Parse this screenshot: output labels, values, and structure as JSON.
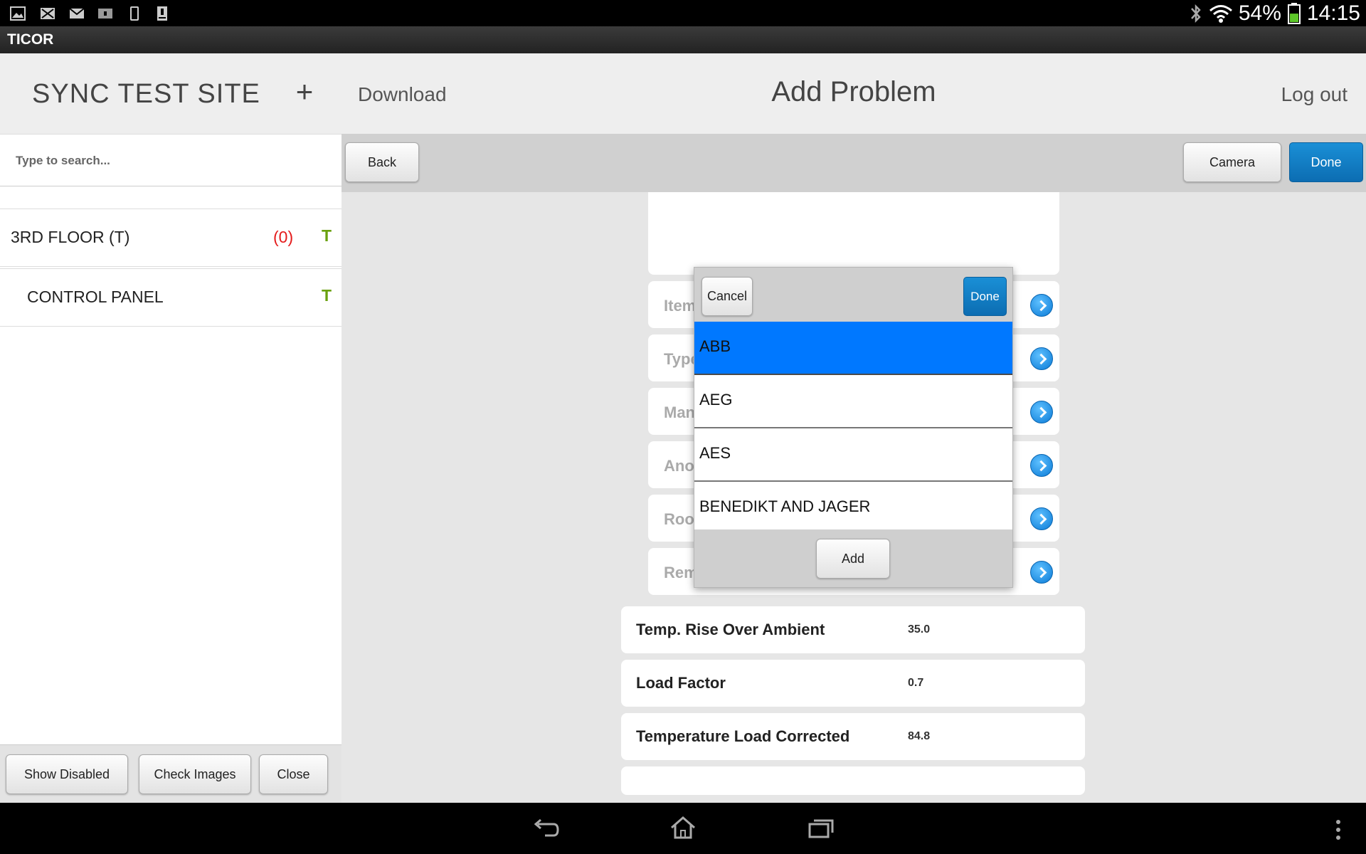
{
  "status_bar": {
    "left_icons": [
      "gallery-icon",
      "mail-x-icon",
      "email-icon",
      "storage-icon",
      "phone-icon",
      "download-icon"
    ],
    "bluetooth_icon": "bluetooth-icon",
    "wifi_icon": "wifi-icon",
    "battery_percent": "54%",
    "battery_icon": "battery-icon",
    "battery_level": 0.54,
    "time": "14:15"
  },
  "app": {
    "title": "TICOR"
  },
  "sidebar": {
    "site_title": "SYNC TEST SITE",
    "add_label": "+",
    "search": {
      "placeholder": "Type to search...",
      "value": ""
    },
    "items": [
      {
        "label": "3RD FLOOR (T)",
        "count": "(0)",
        "flag": "T"
      },
      {
        "label": "CONTROL PANEL",
        "count": "",
        "flag": "T"
      }
    ],
    "footer": {
      "show_disabled": "Show Disabled",
      "check_images": "Check Images",
      "close": "Close"
    }
  },
  "header": {
    "download": "Download",
    "title": "Add Problem",
    "logout": "Log out"
  },
  "toolbar": {
    "back": "Back",
    "camera": "Camera",
    "done": "Done"
  },
  "form": {
    "fields": [
      {
        "label": "Item"
      },
      {
        "label": "Type"
      },
      {
        "label": "Man"
      },
      {
        "label": "Anor"
      },
      {
        "label": "Root"
      },
      {
        "label": "Rem"
      }
    ],
    "values": [
      {
        "label": "Temp. Rise Over Ambient",
        "value": "35.0"
      },
      {
        "label": "Load Factor",
        "value": "0.7"
      },
      {
        "label": "Temperature Load Corrected",
        "value": "84.8"
      }
    ]
  },
  "picker": {
    "cancel": "Cancel",
    "done": "Done",
    "add": "Add",
    "options": [
      "ABB",
      "AEG",
      "AES",
      "BENEDIKT AND JAGER"
    ],
    "selected": "ABB"
  },
  "colors": {
    "accent_blue": "#0c7cc7",
    "selection_blue": "#0078ff",
    "count_red": "#e41b1b",
    "flag_green": "#6aa10f"
  }
}
